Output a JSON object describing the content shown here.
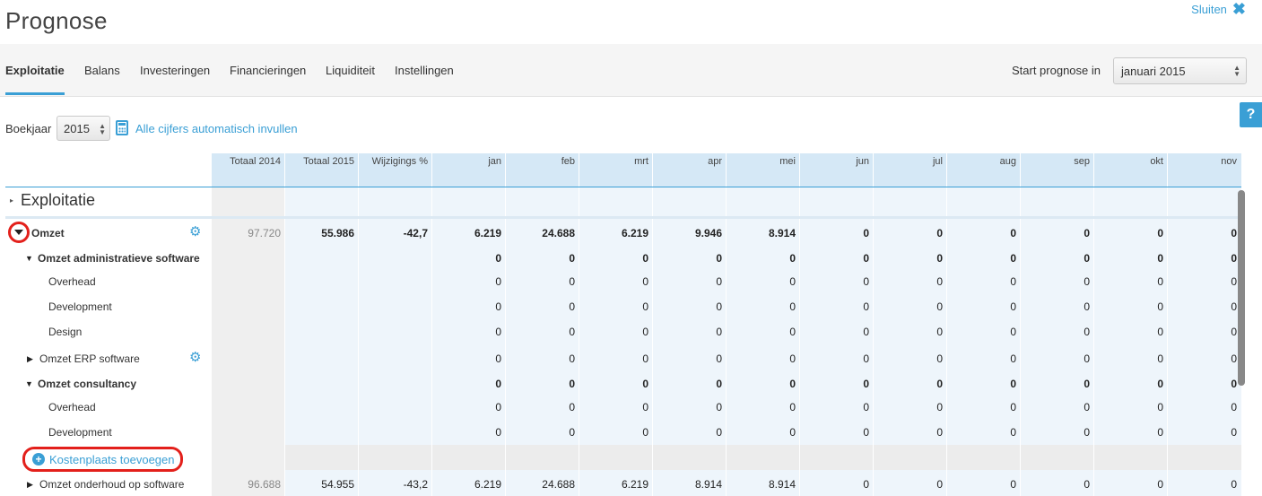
{
  "header": {
    "title": "Prognose",
    "close_label": "Sluiten"
  },
  "tabs": [
    {
      "label": "Exploitatie",
      "active": true
    },
    {
      "label": "Balans"
    },
    {
      "label": "Investeringen"
    },
    {
      "label": "Financieringen"
    },
    {
      "label": "Liquiditeit"
    },
    {
      "label": "Instellingen"
    }
  ],
  "start": {
    "label": "Start prognose in",
    "value": "januari 2015"
  },
  "toolbar": {
    "boekjaar_label": "Boekjaar",
    "boekjaar_value": "2015",
    "autofill_label": "Alle cijfers automatisch invullen"
  },
  "help": {
    "label": "?"
  },
  "columns": [
    "Totaal 2014",
    "Totaal 2015",
    "Wijzigings %",
    "jan",
    "feb",
    "mrt",
    "apr",
    "mei",
    "jun",
    "jul",
    "aug",
    "sep",
    "okt",
    "nov"
  ],
  "section": {
    "label": "Exploitatie"
  },
  "rows": [
    {
      "label": "Omzet",
      "values": [
        "97.720",
        "55.986",
        "-42,7",
        "6.219",
        "24.688",
        "6.219",
        "9.946",
        "8.914",
        "0",
        "0",
        "0",
        "0",
        "0",
        "0"
      ]
    },
    {
      "label": "Omzet administratieve software",
      "values": [
        "",
        "",
        "",
        "0",
        "0",
        "0",
        "0",
        "0",
        "0",
        "0",
        "0",
        "0",
        "0",
        "0"
      ]
    },
    {
      "label": "Overhead",
      "values": [
        "",
        "",
        "",
        "0",
        "0",
        "0",
        "0",
        "0",
        "0",
        "0",
        "0",
        "0",
        "0",
        "0"
      ]
    },
    {
      "label": "Development",
      "values": [
        "",
        "",
        "",
        "0",
        "0",
        "0",
        "0",
        "0",
        "0",
        "0",
        "0",
        "0",
        "0",
        "0"
      ]
    },
    {
      "label": "Design",
      "values": [
        "",
        "",
        "",
        "0",
        "0",
        "0",
        "0",
        "0",
        "0",
        "0",
        "0",
        "0",
        "0",
        "0"
      ]
    },
    {
      "label": "Omzet ERP software",
      "values": [
        "",
        "",
        "",
        "0",
        "0",
        "0",
        "0",
        "0",
        "0",
        "0",
        "0",
        "0",
        "0",
        "0"
      ]
    },
    {
      "label": "Omzet consultancy",
      "values": [
        "",
        "",
        "",
        "0",
        "0",
        "0",
        "0",
        "0",
        "0",
        "0",
        "0",
        "0",
        "0",
        "0"
      ]
    },
    {
      "label": "Overhead",
      "values": [
        "",
        "",
        "",
        "0",
        "0",
        "0",
        "0",
        "0",
        "0",
        "0",
        "0",
        "0",
        "0",
        "0"
      ]
    },
    {
      "label": "Development",
      "values": [
        "",
        "",
        "",
        "0",
        "0",
        "0",
        "0",
        "0",
        "0",
        "0",
        "0",
        "0",
        "0",
        "0"
      ]
    },
    {
      "label": "Omzet onderhoud op software",
      "values": [
        "96.688",
        "54.955",
        "-43,2",
        "6.219",
        "24.688",
        "6.219",
        "8.914",
        "8.914",
        "0",
        "0",
        "0",
        "0",
        "0",
        "0"
      ]
    }
  ],
  "add_cost_center": {
    "label": "Kostenplaats toevoegen"
  }
}
